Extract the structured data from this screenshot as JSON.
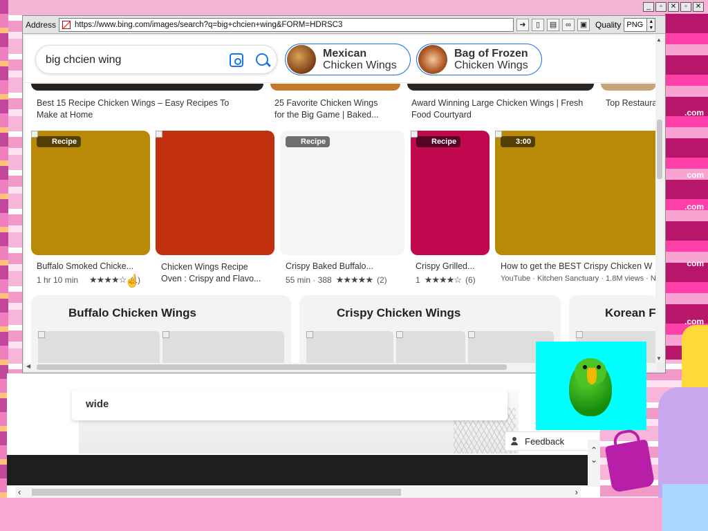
{
  "browser": {
    "address_label": "Address",
    "url": "https://www.bing.com/images/search?q=big+chcien+wing&FORM=HDRSC3",
    "quality_label": "Quality",
    "quality_value": "PNG"
  },
  "search": {
    "query": "big chcien wing"
  },
  "related_pills": [
    {
      "title": "Mexican",
      "subtitle": "Chicken Wings"
    },
    {
      "title": "Bag of Frozen",
      "subtitle": "Chicken Wings"
    }
  ],
  "top_row_captions": [
    {
      "line1": "Best 15 Recipe Chicken Wings – Easy Recipes To",
      "line2": "Make at Home"
    },
    {
      "line1": "25 Favorite Chicken Wings",
      "line2": "for the Big Game | Baked..."
    },
    {
      "line1": "Award Winning Large Chicken Wings | Fresh",
      "line2": "Food Courtyard"
    },
    {
      "line1": "Top Restaura",
      "line2": ""
    }
  ],
  "results": [
    {
      "badge": "Recipe",
      "color": "#b98a07",
      "title": "Buffalo Smoked Chicke...",
      "time": "1 hr 10 min",
      "stars": "★★★★☆",
      "reviews": "(1)"
    },
    {
      "badge": "",
      "color": "#c1300f",
      "title": "Chicken Wings Recipe",
      "title2": "Oven : Crispy and Flavo..."
    },
    {
      "badge": "Recipe",
      "color": "#f5f5f5",
      "title": "Crispy Baked Buffalo...",
      "time": "55 min · 388",
      "stars": "★★★★★",
      "reviews": "(2)"
    },
    {
      "badge": "Recipe",
      "color": "#c0084f",
      "title": "Crispy Grilled...",
      "time": "1",
      "stars": "★★★★☆",
      "reviews": "(6)"
    },
    {
      "badge": "3:00",
      "color": "#b98a07",
      "title": "How to get the BEST Crispy Chicken W",
      "source": "YouTube · Kitchen Sanctuary · 1.8M views · N"
    }
  ],
  "panels": [
    {
      "title": "Buffalo Chicken Wings"
    },
    {
      "title": "Crispy Chicken Wings"
    },
    {
      "title": "Korean F"
    }
  ],
  "lower_window": {
    "wide_label": "wide",
    "feedback_label": "Feedback"
  },
  "desktop": {
    "com_labels": [
      ".com",
      "com",
      ".com",
      "com",
      ".com"
    ]
  }
}
